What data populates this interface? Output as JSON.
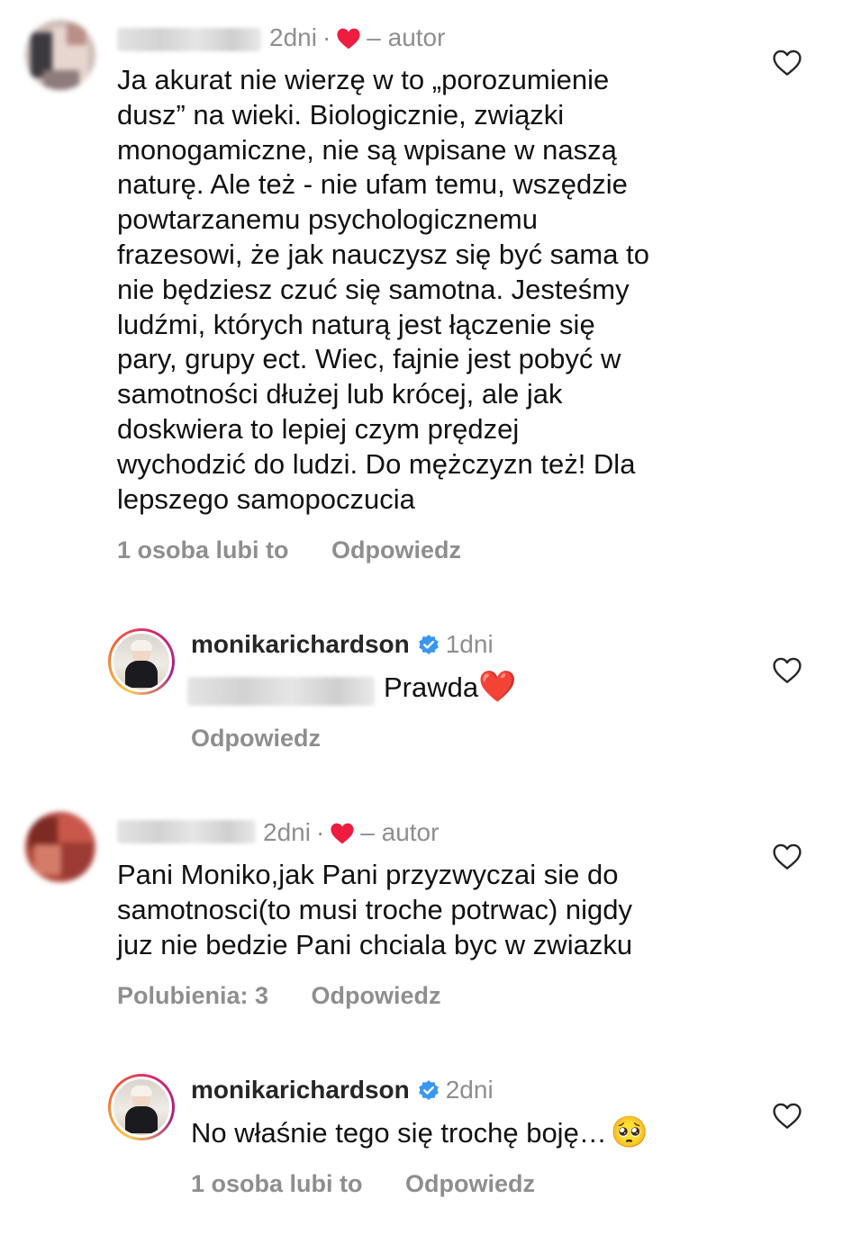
{
  "comments": [
    {
      "time": "2dni",
      "separator": "·",
      "author_label": "– autor",
      "text": "Ja akurat nie wierzę w to „porozumienie\ndusz” na wieki. Biologicznie, związki\nmonogamiczne, nie są wpisane w naszą\nnaturę. Ale też - nie  ufam temu, wszędzie\npowtarzanemu psychologicznemu\nfrazesowi, że jak nauczysz się być sama to\nnie będziesz czuć się samotna. Jesteśmy\nludźmi, których naturą jest łączenie się\npary, grupy ect. Wiec, fajnie jest pobyć w\nsamotności dłużej lub krócej, ale jak\ndoskwiera to lepiej czym prędzej\nwychodzić do ludzi. Do mężczyzn też! Dla\nlepszego samopoczucia",
      "likes": "1 osoba lubi to",
      "reply": "Odpowiedz",
      "reply_thread": {
        "username": "monikarichardson",
        "time": "1dni",
        "text": "Prawda",
        "emoji": "❤️",
        "reply": "Odpowiedz"
      }
    },
    {
      "time": "2dni",
      "separator": "·",
      "author_label": "– autor",
      "text": "Pani Moniko,jak Pani przyzwyczai sie do\nsamotnosci(to musi troche potrwac) nigdy\njuz nie bedzie Pani chciala byc w zwiazku",
      "likes": "Polubienia: 3",
      "reply": "Odpowiedz",
      "reply_thread": {
        "username": "monikarichardson",
        "time": "2dni",
        "text": "No właśnie tego się trochę boję…",
        "emoji": "🥺",
        "likes": "1 osoba lubi to",
        "reply": "Odpowiedz"
      }
    }
  ],
  "icons": {
    "like": "heart-outline-icon",
    "author_heart": "heart-filled-icon",
    "verified": "verified-badge-icon"
  },
  "colors": {
    "text": "#111111",
    "meta": "#8e8e8e",
    "heart_red": "#ee1d3f",
    "verified_blue": "#3897f0"
  }
}
